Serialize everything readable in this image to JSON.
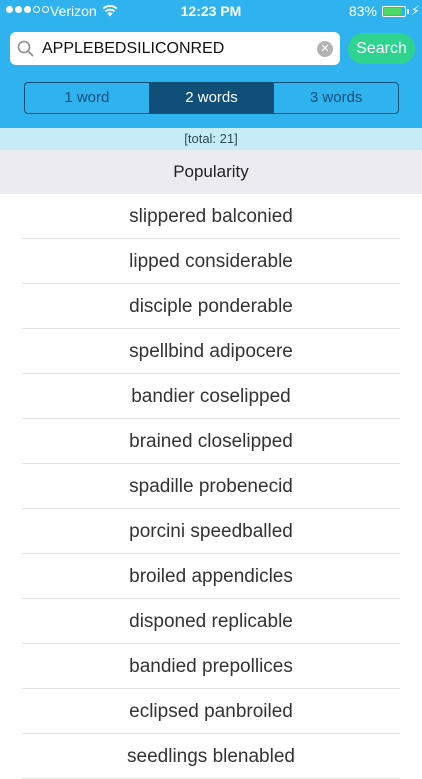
{
  "status_bar": {
    "carrier": "Verizon",
    "time": "12:23 PM",
    "battery_percent": "83%",
    "battery_level": 0.83,
    "signal_bars": 3,
    "signal_total": 5
  },
  "search": {
    "value": "APPLEBEDSILICONRED",
    "button_label": "Search"
  },
  "tabs": [
    {
      "label": "1 word",
      "active": false
    },
    {
      "label": "2 words",
      "active": true
    },
    {
      "label": "3 words",
      "active": false
    }
  ],
  "total_label": "[total: 21]",
  "sort_label": "Popularity",
  "results": [
    "slippered balconied",
    "lipped considerable",
    "disciple ponderable",
    "spellbind adipocere",
    "bandier coselipped",
    "brained closelipped",
    "spadille probenecid",
    "porcini speedballed",
    "broiled appendicles",
    "disponed replicable",
    "bandied prepollices",
    "eclipsed panbroiled",
    "seedlings blenabled"
  ],
  "colors": {
    "header": "#2fb3ef",
    "segment": "#0f4f78",
    "search_button": "#2dd38f",
    "battery": "#4cd964"
  },
  "icons": {
    "search": "magnifier",
    "clear": "circled-x",
    "wifi": "wifi-fan",
    "charge": "lightning-bolt"
  }
}
